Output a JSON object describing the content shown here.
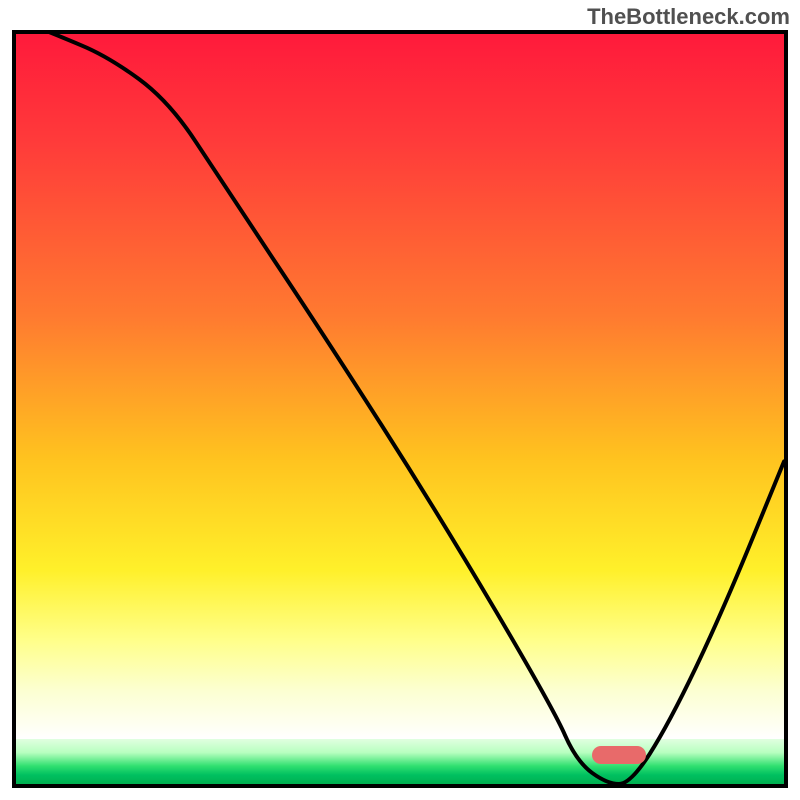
{
  "watermark": "TheBottleneck.com",
  "chart_data": {
    "type": "line",
    "title": "",
    "xlabel": "",
    "ylabel": "",
    "x": [
      0,
      5,
      12,
      20,
      27,
      40,
      55,
      70,
      73,
      77,
      80,
      85,
      92,
      100
    ],
    "values": [
      102,
      100,
      97,
      91,
      80,
      60,
      36,
      10,
      3,
      0,
      0,
      8,
      23,
      43
    ],
    "ylim": [
      0,
      100
    ],
    "xlim": [
      0,
      100
    ],
    "sweet_spot_x": [
      75,
      82
    ],
    "sweet_spot_y": 0,
    "background_gradient": {
      "top": "#ff1a3b",
      "upper_mid": "#ff7a30",
      "mid": "#ffc21f",
      "lower_mid": "#fff02a",
      "near_bottom": "#fcffd0",
      "bottom_band": "#00c060"
    }
  }
}
